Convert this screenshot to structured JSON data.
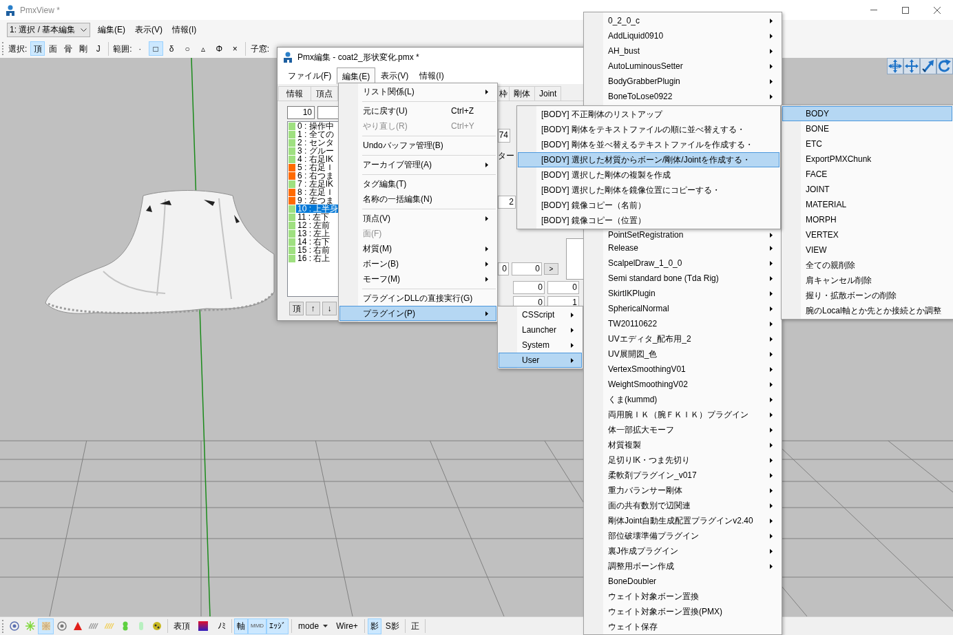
{
  "main_window": {
    "title": "PmxView *",
    "mode_select": {
      "value": "1: 選択 / 基本編集"
    },
    "menu": [
      {
        "label": "編集(E)"
      },
      {
        "label": "表示(V)"
      },
      {
        "label": "情報(I)"
      }
    ],
    "toolbar": {
      "select_label": "選択:",
      "select_buttons": [
        {
          "label": "頂",
          "selected": true
        },
        {
          "label": "面",
          "selected": false
        },
        {
          "label": "骨",
          "selected": false
        },
        {
          "label": "剛",
          "selected": false
        },
        {
          "label": "J",
          "selected": false
        }
      ],
      "range_label": "範囲:",
      "range_buttons": [
        {
          "label": "·",
          "selected": false
        },
        {
          "label": "□",
          "selected": true
        },
        {
          "label": "δ",
          "selected": false
        },
        {
          "label": "○",
          "selected": false
        },
        {
          "label": "▵",
          "selected": false
        },
        {
          "label": "Φ",
          "selected": false
        },
        {
          "label": "×",
          "selected": false
        }
      ],
      "subwindow_label": "子窓:"
    },
    "bottom_toolbar": {
      "display_toggles": [
        {
          "selected": false
        },
        {
          "selected": false
        },
        {
          "selected": true
        },
        {
          "selected": false
        },
        {
          "selected": false
        },
        {
          "selected": false
        },
        {
          "selected": false
        },
        {
          "selected": false
        },
        {
          "selected": false
        },
        {
          "selected": false
        }
      ],
      "face_button": {
        "label": "表頂"
      },
      "nomi_button": {
        "label": "ﾉﾐ"
      },
      "axis_toggles": [
        {
          "label": "軸",
          "selected": true
        },
        {
          "label": "MMD",
          "selected": true
        },
        {
          "label": "ｴｯｼﾞ",
          "selected": true
        }
      ],
      "mode_dropdown": {
        "label": "mode"
      },
      "wire_button": {
        "label": "Wire+"
      },
      "shadow_toggles": [
        {
          "label": "影",
          "selected": true
        },
        {
          "label": "S影",
          "selected": false
        }
      ],
      "ortho_button": {
        "label": "正"
      }
    }
  },
  "pmx_editor": {
    "title": "Pmx編集 - coat2_形状変化.pmx *",
    "menu": [
      {
        "label": "ファイル(F)",
        "open": false
      },
      {
        "label": "編集(E)",
        "open": true
      },
      {
        "label": "表示(V)",
        "open": false
      },
      {
        "label": "情報(I)",
        "open": false
      }
    ],
    "tabs_left": [
      {
        "label": "情報",
        "selected": false
      },
      {
        "label": "頂点",
        "selected": false
      }
    ],
    "tabs_right": [
      {
        "label": "枠",
        "selected": false
      },
      {
        "label": "剛体",
        "selected": false
      },
      {
        "label": "Joint",
        "selected": false
      }
    ],
    "index_field": {
      "value": "10"
    },
    "list": [
      {
        "label": "0 : 操作中",
        "color": "#9fe080",
        "selected": false
      },
      {
        "label": "1 : 全ての",
        "color": "#9fe080",
        "selected": false
      },
      {
        "label": "2 : センタ",
        "color": "#9fe080",
        "selected": false
      },
      {
        "label": "3 : グルー",
        "color": "#9fe080",
        "selected": false
      },
      {
        "label": "4 : 右足IK",
        "color": "#9fe080",
        "selected": false
      },
      {
        "label": "5 : 右足Ｉ",
        "color": "#ff6a00",
        "selected": false
      },
      {
        "label": "6 : 右つま",
        "color": "#ff6a00",
        "selected": false
      },
      {
        "label": "7 : 左足IK",
        "color": "#9fe080",
        "selected": false
      },
      {
        "label": "8 : 左足Ｉ",
        "color": "#ff6a00",
        "selected": false
      },
      {
        "label": "9 : 左つま",
        "color": "#ff6a00",
        "selected": false
      },
      {
        "label": "10 : 上半身",
        "color": "#9fe080",
        "selected": true
      },
      {
        "label": "11 : 左下",
        "color": "#9fe080",
        "selected": false
      },
      {
        "label": "12 : 左前",
        "color": "#9fe080",
        "selected": false
      },
      {
        "label": "13 : 左上",
        "color": "#9fe080",
        "selected": false
      },
      {
        "label": "14 : 右下",
        "color": "#9fe080",
        "selected": false
      },
      {
        "label": "15 : 右前",
        "color": "#9fe080",
        "selected": false
      },
      {
        "label": "16 : 右上",
        "color": "#9fe080",
        "selected": false
      }
    ],
    "list_buttons": [
      {
        "label": "頂"
      },
      {
        "label": "↑"
      },
      {
        "label": "↓"
      }
    ],
    "fragments": [
      {
        "kind": "field",
        "value": "74"
      },
      {
        "kind": "label",
        "text": "ター"
      },
      {
        "kind": "field",
        "value": "2"
      },
      {
        "kind": "field",
        "value": "0"
      },
      {
        "kind": "field",
        "value": "0"
      },
      {
        "kind": "button",
        "label": ">"
      },
      {
        "kind": "field",
        "value": "0"
      },
      {
        "kind": "field",
        "value": "0"
      },
      {
        "kind": "field",
        "value": "0"
      },
      {
        "kind": "field",
        "value": "1"
      }
    ]
  },
  "edit_menu": {
    "items": [
      {
        "kind": "item",
        "label": "リスト関係(L)",
        "submenu": true,
        "disabled": false,
        "selected": false
      },
      {
        "kind": "separator"
      },
      {
        "kind": "item",
        "label": "元に戻す(U)",
        "shortcut": "Ctrl+Z",
        "submenu": false,
        "disabled": false,
        "selected": false
      },
      {
        "kind": "item",
        "label": "やり直し(R)",
        "shortcut": "Ctrl+Y",
        "submenu": false,
        "disabled": true,
        "selected": false
      },
      {
        "kind": "separator"
      },
      {
        "kind": "item",
        "label": "Undoバッファ管理(B)",
        "submenu": false,
        "disabled": false,
        "selected": false
      },
      {
        "kind": "separator"
      },
      {
        "kind": "item",
        "label": "アーカイブ管理(A)",
        "submenu": true,
        "disabled": false,
        "selected": false
      },
      {
        "kind": "separator"
      },
      {
        "kind": "item",
        "label": "タグ編集(T)",
        "submenu": false,
        "disabled": false,
        "selected": false
      },
      {
        "kind": "item",
        "label": "名称の一括編集(N)",
        "submenu": false,
        "disabled": false,
        "selected": false
      },
      {
        "kind": "separator"
      },
      {
        "kind": "item",
        "label": "頂点(V)",
        "submenu": true,
        "disabled": false,
        "selected": false
      },
      {
        "kind": "item",
        "label": "面(F)",
        "submenu": false,
        "disabled": true,
        "selected": false
      },
      {
        "kind": "item",
        "label": "材質(M)",
        "submenu": true,
        "disabled": false,
        "selected": false
      },
      {
        "kind": "item",
        "label": "ボーン(B)",
        "submenu": true,
        "disabled": false,
        "selected": false
      },
      {
        "kind": "item",
        "label": "モーフ(M)",
        "submenu": true,
        "disabled": false,
        "selected": false
      },
      {
        "kind": "separator"
      },
      {
        "kind": "item",
        "label": "プラグインDLLの直接実行(G)",
        "submenu": false,
        "disabled": false,
        "selected": false
      },
      {
        "kind": "item",
        "label": "プラグイン(P)",
        "submenu": true,
        "disabled": false,
        "selected": true
      }
    ]
  },
  "plugin_menu": {
    "items": [
      {
        "label": "CSScript",
        "submenu": true,
        "selected": false
      },
      {
        "label": "Launcher",
        "submenu": true,
        "selected": false
      },
      {
        "label": "System",
        "submenu": true,
        "selected": false
      },
      {
        "label": "User",
        "submenu": true,
        "selected": true
      }
    ]
  },
  "user_menu": {
    "items_top": [
      {
        "label": "0_2_0_c",
        "submenu": true,
        "selected": false
      },
      {
        "label": "AddLiquid0910",
        "submenu": true,
        "selected": false
      },
      {
        "label": "AH_bust",
        "submenu": true,
        "selected": false
      },
      {
        "label": "AutoLuminousSetter",
        "submenu": true,
        "selected": false
      },
      {
        "label": "BodyGrabberPlugin",
        "submenu": true,
        "selected": false
      },
      {
        "label": "BoneToLose0922",
        "submenu": true,
        "selected": false
      }
    ],
    "items_bottom": [
      {
        "label": "PointSetRegistration",
        "submenu": true,
        "selected": false
      },
      {
        "label": "Release",
        "submenu": true,
        "selected": false
      },
      {
        "label": "ScalpelDraw_1_0_0",
        "submenu": true,
        "selected": false
      },
      {
        "label": "Semi standard bone (Tda Rig)",
        "submenu": true,
        "selected": false
      },
      {
        "label": "SkirtIKPlugin",
        "submenu": true,
        "selected": false
      },
      {
        "label": "SphericalNormal",
        "submenu": true,
        "selected": false
      },
      {
        "label": "TW20110622",
        "submenu": true,
        "selected": false
      },
      {
        "label": "UVエディタ_配布用_2",
        "submenu": true,
        "selected": false
      },
      {
        "label": "UV展開図_色",
        "submenu": true,
        "selected": false
      },
      {
        "label": "VertexSmoothingV01",
        "submenu": true,
        "selected": false
      },
      {
        "label": "WeightSmoothingV02",
        "submenu": true,
        "selected": false
      },
      {
        "label": "くま(kummd)",
        "submenu": true,
        "selected": false
      },
      {
        "label": "両用腕ＩＫ（腕ＦＫＩＫ）プラグイン",
        "submenu": true,
        "selected": false
      },
      {
        "label": "体一部拡大モーフ",
        "submenu": true,
        "selected": false
      },
      {
        "label": "材質複製",
        "submenu": true,
        "selected": false
      },
      {
        "label": "足切りIK・つま先切り",
        "submenu": true,
        "selected": false
      },
      {
        "label": "柔軟剤プラグイン_v017",
        "submenu": true,
        "selected": false
      },
      {
        "label": "重力バランサー剛体",
        "submenu": true,
        "selected": false
      },
      {
        "label": "面の共有数別で辺関連",
        "submenu": true,
        "selected": false
      },
      {
        "label": "剛体Joint自動生成配置プラグインv2.40",
        "submenu": true,
        "selected": false
      },
      {
        "label": "部位破壊準備プラグイン",
        "submenu": true,
        "selected": false
      },
      {
        "label": "裏J作成プラグイン",
        "submenu": true,
        "selected": false
      },
      {
        "label": "調整用ボーン作成",
        "submenu": true,
        "selected": false
      },
      {
        "label": "BoneDoubler",
        "submenu": false,
        "selected": false
      },
      {
        "label": "ウェイト対象ボーン置換",
        "submenu": false,
        "selected": false
      },
      {
        "label": "ウェイト対象ボーン置換(PMX)",
        "submenu": false,
        "selected": false
      },
      {
        "label": "ウェイト保存",
        "submenu": false,
        "selected": false
      }
    ]
  },
  "category_menu": {
    "items": [
      {
        "label": "BODY",
        "selected": true
      },
      {
        "label": "BONE",
        "selected": false
      },
      {
        "label": "ETC",
        "selected": false
      },
      {
        "label": "ExportPMXChunk",
        "selected": false
      },
      {
        "label": "FACE",
        "selected": false
      },
      {
        "label": "JOINT",
        "selected": false
      },
      {
        "label": "MATERIAL",
        "selected": false
      },
      {
        "label": "MORPH",
        "selected": false
      },
      {
        "label": "VERTEX",
        "selected": false
      },
      {
        "label": "VIEW",
        "selected": false
      },
      {
        "label": "全ての親削除",
        "selected": false
      },
      {
        "label": "肩キャンセル削除",
        "selected": false
      },
      {
        "label": "握り・拡散ボーンの削除",
        "selected": false
      },
      {
        "label": "腕のLocal軸とか先とか接続とか調整",
        "selected": false
      }
    ]
  },
  "body_menu": {
    "items": [
      {
        "label": "[BODY] 不正剛体のリストアップ",
        "selected": false
      },
      {
        "label": "[BODY] 剛体をテキストファイルの順に並べ替えする・",
        "selected": false
      },
      {
        "label": "[BODY] 剛体を並べ替えるテキストファイルを作成する・",
        "selected": false
      },
      {
        "label": "[BODY] 選択した材質からボーン/剛体/Jointを作成する・",
        "selected": true
      },
      {
        "label": "[BODY] 選択した剛体の複製を作成",
        "selected": false
      },
      {
        "label": "[BODY] 選択した剛体を鏡像位置にコピーする・",
        "selected": false
      },
      {
        "label": "[BODY] 鏡像コピー（名前）",
        "selected": false
      },
      {
        "label": "[BODY] 鏡像コピー（位置）",
        "selected": false
      }
    ]
  }
}
